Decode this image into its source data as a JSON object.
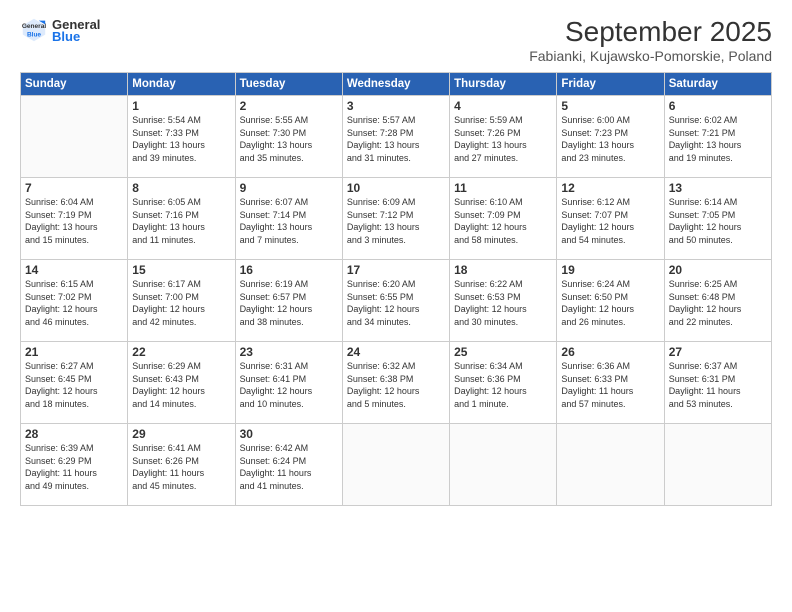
{
  "logo": {
    "general": "General",
    "blue": "Blue"
  },
  "title": "September 2025",
  "location": "Fabianki, Kujawsko-Pomorskie, Poland",
  "headers": [
    "Sunday",
    "Monday",
    "Tuesday",
    "Wednesday",
    "Thursday",
    "Friday",
    "Saturday"
  ],
  "weeks": [
    [
      {
        "day": "",
        "content": ""
      },
      {
        "day": "1",
        "content": "Sunrise: 5:54 AM\nSunset: 7:33 PM\nDaylight: 13 hours\nand 39 minutes."
      },
      {
        "day": "2",
        "content": "Sunrise: 5:55 AM\nSunset: 7:30 PM\nDaylight: 13 hours\nand 35 minutes."
      },
      {
        "day": "3",
        "content": "Sunrise: 5:57 AM\nSunset: 7:28 PM\nDaylight: 13 hours\nand 31 minutes."
      },
      {
        "day": "4",
        "content": "Sunrise: 5:59 AM\nSunset: 7:26 PM\nDaylight: 13 hours\nand 27 minutes."
      },
      {
        "day": "5",
        "content": "Sunrise: 6:00 AM\nSunset: 7:23 PM\nDaylight: 13 hours\nand 23 minutes."
      },
      {
        "day": "6",
        "content": "Sunrise: 6:02 AM\nSunset: 7:21 PM\nDaylight: 13 hours\nand 19 minutes."
      }
    ],
    [
      {
        "day": "7",
        "content": "Sunrise: 6:04 AM\nSunset: 7:19 PM\nDaylight: 13 hours\nand 15 minutes."
      },
      {
        "day": "8",
        "content": "Sunrise: 6:05 AM\nSunset: 7:16 PM\nDaylight: 13 hours\nand 11 minutes."
      },
      {
        "day": "9",
        "content": "Sunrise: 6:07 AM\nSunset: 7:14 PM\nDaylight: 13 hours\nand 7 minutes."
      },
      {
        "day": "10",
        "content": "Sunrise: 6:09 AM\nSunset: 7:12 PM\nDaylight: 13 hours\nand 3 minutes."
      },
      {
        "day": "11",
        "content": "Sunrise: 6:10 AM\nSunset: 7:09 PM\nDaylight: 12 hours\nand 58 minutes."
      },
      {
        "day": "12",
        "content": "Sunrise: 6:12 AM\nSunset: 7:07 PM\nDaylight: 12 hours\nand 54 minutes."
      },
      {
        "day": "13",
        "content": "Sunrise: 6:14 AM\nSunset: 7:05 PM\nDaylight: 12 hours\nand 50 minutes."
      }
    ],
    [
      {
        "day": "14",
        "content": "Sunrise: 6:15 AM\nSunset: 7:02 PM\nDaylight: 12 hours\nand 46 minutes."
      },
      {
        "day": "15",
        "content": "Sunrise: 6:17 AM\nSunset: 7:00 PM\nDaylight: 12 hours\nand 42 minutes."
      },
      {
        "day": "16",
        "content": "Sunrise: 6:19 AM\nSunset: 6:57 PM\nDaylight: 12 hours\nand 38 minutes."
      },
      {
        "day": "17",
        "content": "Sunrise: 6:20 AM\nSunset: 6:55 PM\nDaylight: 12 hours\nand 34 minutes."
      },
      {
        "day": "18",
        "content": "Sunrise: 6:22 AM\nSunset: 6:53 PM\nDaylight: 12 hours\nand 30 minutes."
      },
      {
        "day": "19",
        "content": "Sunrise: 6:24 AM\nSunset: 6:50 PM\nDaylight: 12 hours\nand 26 minutes."
      },
      {
        "day": "20",
        "content": "Sunrise: 6:25 AM\nSunset: 6:48 PM\nDaylight: 12 hours\nand 22 minutes."
      }
    ],
    [
      {
        "day": "21",
        "content": "Sunrise: 6:27 AM\nSunset: 6:45 PM\nDaylight: 12 hours\nand 18 minutes."
      },
      {
        "day": "22",
        "content": "Sunrise: 6:29 AM\nSunset: 6:43 PM\nDaylight: 12 hours\nand 14 minutes."
      },
      {
        "day": "23",
        "content": "Sunrise: 6:31 AM\nSunset: 6:41 PM\nDaylight: 12 hours\nand 10 minutes."
      },
      {
        "day": "24",
        "content": "Sunrise: 6:32 AM\nSunset: 6:38 PM\nDaylight: 12 hours\nand 5 minutes."
      },
      {
        "day": "25",
        "content": "Sunrise: 6:34 AM\nSunset: 6:36 PM\nDaylight: 12 hours\nand 1 minute."
      },
      {
        "day": "26",
        "content": "Sunrise: 6:36 AM\nSunset: 6:33 PM\nDaylight: 11 hours\nand 57 minutes."
      },
      {
        "day": "27",
        "content": "Sunrise: 6:37 AM\nSunset: 6:31 PM\nDaylight: 11 hours\nand 53 minutes."
      }
    ],
    [
      {
        "day": "28",
        "content": "Sunrise: 6:39 AM\nSunset: 6:29 PM\nDaylight: 11 hours\nand 49 minutes."
      },
      {
        "day": "29",
        "content": "Sunrise: 6:41 AM\nSunset: 6:26 PM\nDaylight: 11 hours\nand 45 minutes."
      },
      {
        "day": "30",
        "content": "Sunrise: 6:42 AM\nSunset: 6:24 PM\nDaylight: 11 hours\nand 41 minutes."
      },
      {
        "day": "",
        "content": ""
      },
      {
        "day": "",
        "content": ""
      },
      {
        "day": "",
        "content": ""
      },
      {
        "day": "",
        "content": ""
      }
    ]
  ]
}
